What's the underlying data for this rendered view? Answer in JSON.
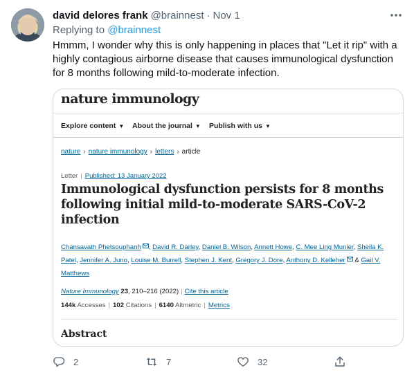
{
  "tweet": {
    "display_name": "david delores frank",
    "handle": "@brainnest",
    "separator": "·",
    "time": "Nov 1",
    "replying_prefix": "Replying to",
    "replying_to": "@brainnest",
    "text": "Hmmm, I wonder why this is only happening in places that \"Let it rip\" with a highly contagious airborne disease that causes immunological dysfunction for 8 months following mild-to-moderate infection."
  },
  "card": {
    "journal_logo": "nature immunology",
    "nav": {
      "explore": "Explore content",
      "about": "About the journal",
      "publish": "Publish with us"
    },
    "breadcrumb": [
      "nature",
      "nature immunology",
      "letters",
      "article"
    ],
    "article_type": "Letter",
    "published": "Published: 13 January 2022",
    "title": "Immunological dysfunction persists for 8 months following initial mild-to-moderate SARS-CoV-2 infection",
    "authors": [
      "Chansavath Phetsouphanh",
      "David R. Darley",
      "Daniel B. Wilson",
      "Annett Howe",
      "C. Mee Ling Munier",
      "Sheila K. Patel",
      "Jennifer A. Juno",
      "Louise M. Burrell",
      "Stephen J. Kent",
      "Gregory J. Dore",
      "Anthony D. Kelleher",
      "Gail V. Matthews"
    ],
    "citation": {
      "journal": "Nature Immunology",
      "volume": "23",
      "pages": ", 210–216 (2022)",
      "cite": "Cite this article"
    },
    "metrics": {
      "accesses_value": "144k",
      "accesses_label": "Accesses",
      "citations_value": "102",
      "citations_label": "Citations",
      "altmetric_value": "6140",
      "altmetric_label": "Altmetric",
      "metrics_link": "Metrics"
    },
    "abstract_heading": "Abstract"
  },
  "actions": {
    "replies": "2",
    "retweets": "7",
    "likes": "32"
  },
  "icons": {
    "more": "more-icon",
    "reply": "reply-icon",
    "retweet": "retweet-icon",
    "like": "heart-icon",
    "share": "share-icon",
    "mail": "mail-icon"
  },
  "colors": {
    "link": "#1d9bf0",
    "secondary_text": "#536471",
    "nature_link": "#006699"
  }
}
